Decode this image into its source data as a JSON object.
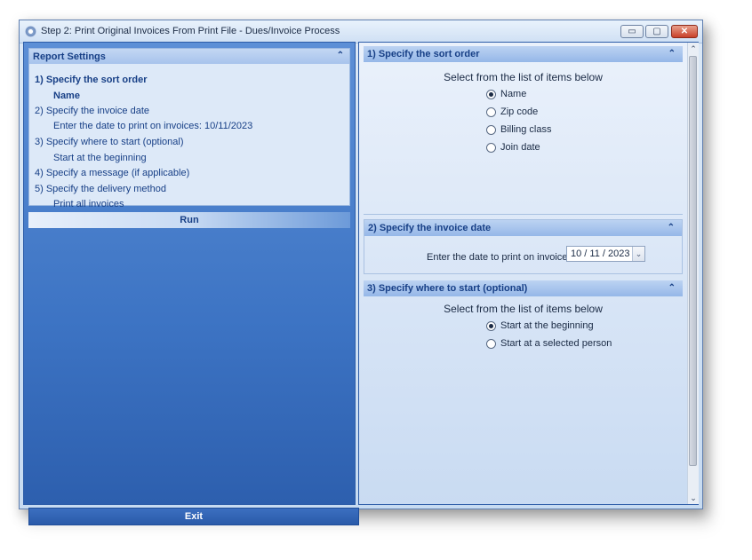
{
  "window": {
    "title": "Step 2: Print Original Invoices From Print File - Dues/Invoice Process",
    "min_glyph": "▭",
    "max_glyph": "▢",
    "close_glyph": "✕"
  },
  "report_settings": {
    "header": "Report Settings",
    "collapse_glyph": "⌃",
    "lines": [
      "1)  Specify the sort order",
      "Name",
      "2)  Specify the invoice date",
      "Enter the date to print on invoices:  10/11/2023",
      "3)  Specify where to start (optional)",
      "Start at the beginning",
      "4)  Specify a message (if applicable)",
      "5)  Specify the delivery method",
      "Print all invoices"
    ]
  },
  "run_label": "Run",
  "exit_label": "Exit",
  "sort_order": {
    "header": "1)  Specify the sort order",
    "prompt": "Select from the list of items below",
    "options": [
      "Name",
      "Zip code",
      "Billing class",
      "Join date"
    ],
    "selected": "Name"
  },
  "invoice_date": {
    "header": "2)  Specify the invoice date",
    "label": "Enter the date to print on invoices:",
    "value": "10  /  11  /  2023",
    "drop_glyph": "⌄"
  },
  "start": {
    "header": "3)  Specify where to start (optional)",
    "prompt": "Select from the list of items below",
    "options": [
      "Start at the beginning",
      "Start at a selected person"
    ],
    "selected": "Start at the beginning"
  },
  "scrollbar": {
    "up_glyph": "⌃",
    "down_glyph": "⌄"
  }
}
